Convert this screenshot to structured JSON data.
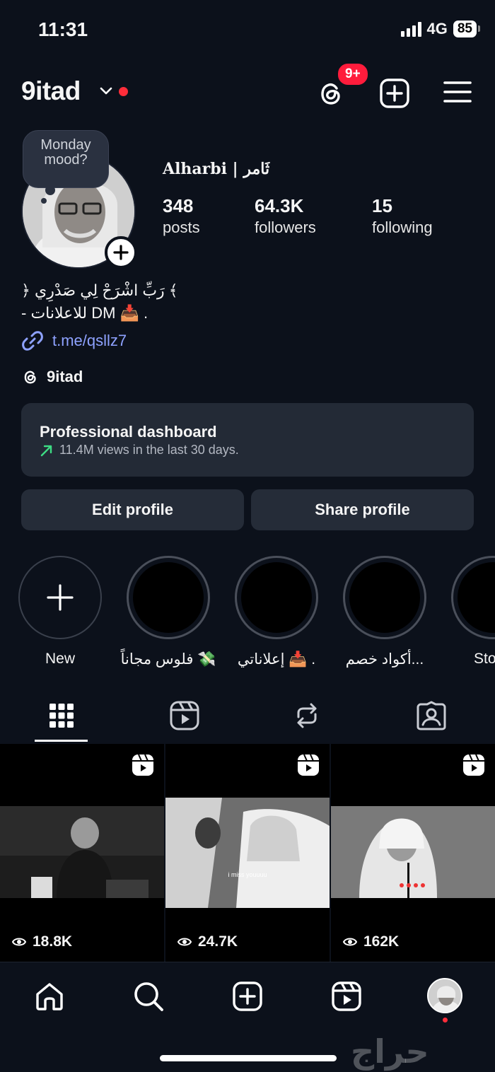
{
  "status_bar": {
    "time": "11:31",
    "network": "4G",
    "battery": "85"
  },
  "header": {
    "username": "9itad",
    "notification_badge": "9+"
  },
  "profile": {
    "mood_bubble": "Monday mood?",
    "display_name": "Alharbi | ثَامر",
    "stats": [
      {
        "value": "348",
        "label": "posts"
      },
      {
        "value": "64.3K",
        "label": "followers"
      },
      {
        "value": "15",
        "label": "following"
      }
    ],
    "bio_line1": "﴿ رَبِّ اشْرَحْ لِي صَدْرِي ﴾",
    "bio_line2": "- للاعلانات DM 📥 .",
    "link": "t.me/qsllz7",
    "threads_handle": "9itad"
  },
  "dashboard": {
    "title": "Professional dashboard",
    "subtitle": "11.4M views in the last 30 days.",
    "trend_color": "#3ddc84"
  },
  "buttons": {
    "edit": "Edit profile",
    "share": "Share profile"
  },
  "highlights": [
    {
      "label": "New"
    },
    {
      "label": "فلوس مجاناً 💸"
    },
    {
      "label": "إعلاناتي 📥 ."
    },
    {
      "label": "أكواد خصم..."
    },
    {
      "label": "Sto"
    }
  ],
  "grid": {
    "posts": [
      {
        "views": "18.8K"
      },
      {
        "views": "24.7K",
        "caption": "i miss youuuu"
      },
      {
        "views": "162K"
      }
    ]
  },
  "watermark": "حراج",
  "icons": {
    "tabs": [
      "grid-icon",
      "reels-icon",
      "reposts-icon",
      "tagged-icon"
    ],
    "nav": [
      "home-icon",
      "search-icon",
      "create-icon",
      "reels-icon",
      "profile-avatar"
    ]
  }
}
